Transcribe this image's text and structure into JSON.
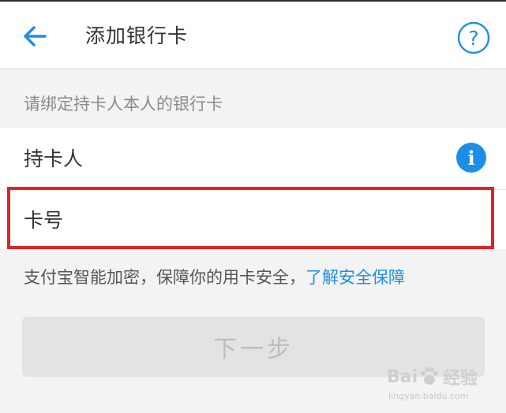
{
  "header": {
    "title": "添加银行卡",
    "back_icon": "arrow-left-icon",
    "help_icon": "question-circle-icon",
    "help_glyph": "?"
  },
  "hint": "请绑定持卡人本人的银行卡",
  "holder_row": {
    "label": "持卡人",
    "info_icon": "info-icon",
    "info_glyph": "i"
  },
  "card_row": {
    "label": "卡号",
    "value": "",
    "placeholder": ""
  },
  "security": {
    "note": "支付宝智能加密，保障你的用卡安全，",
    "link": "了解安全保障"
  },
  "next_button": {
    "label": "下一步"
  },
  "watermark": {
    "brand_left": "Bai",
    "brand_right": "经验",
    "url": "jingyan.baidu.com"
  },
  "colors": {
    "accent": "#1d8ee6",
    "highlight": "#e0232b",
    "background": "#f3f3f3",
    "disabled_button": "#e3e3e3"
  }
}
